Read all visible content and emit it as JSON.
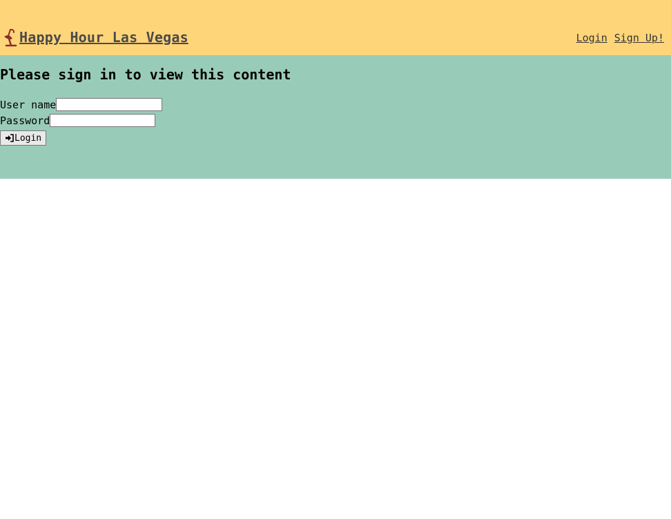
{
  "header": {
    "title": "Happy Hour Las Vegas",
    "logo_icon": "cocktail-glass-icon",
    "nav": {
      "login": "Login",
      "signup": "Sign Up!"
    }
  },
  "main": {
    "heading": "Please sign in to view this content",
    "form": {
      "username_label": "User name",
      "username_value": "",
      "password_label": "Password",
      "password_value": "",
      "submit_label": "Login",
      "submit_icon": "sign-in-icon"
    }
  },
  "colors": {
    "header_bg": "#ffd57a",
    "main_bg": "#99cbb9",
    "page_bg": "#ffffff",
    "logo": "#8b2e2e"
  }
}
